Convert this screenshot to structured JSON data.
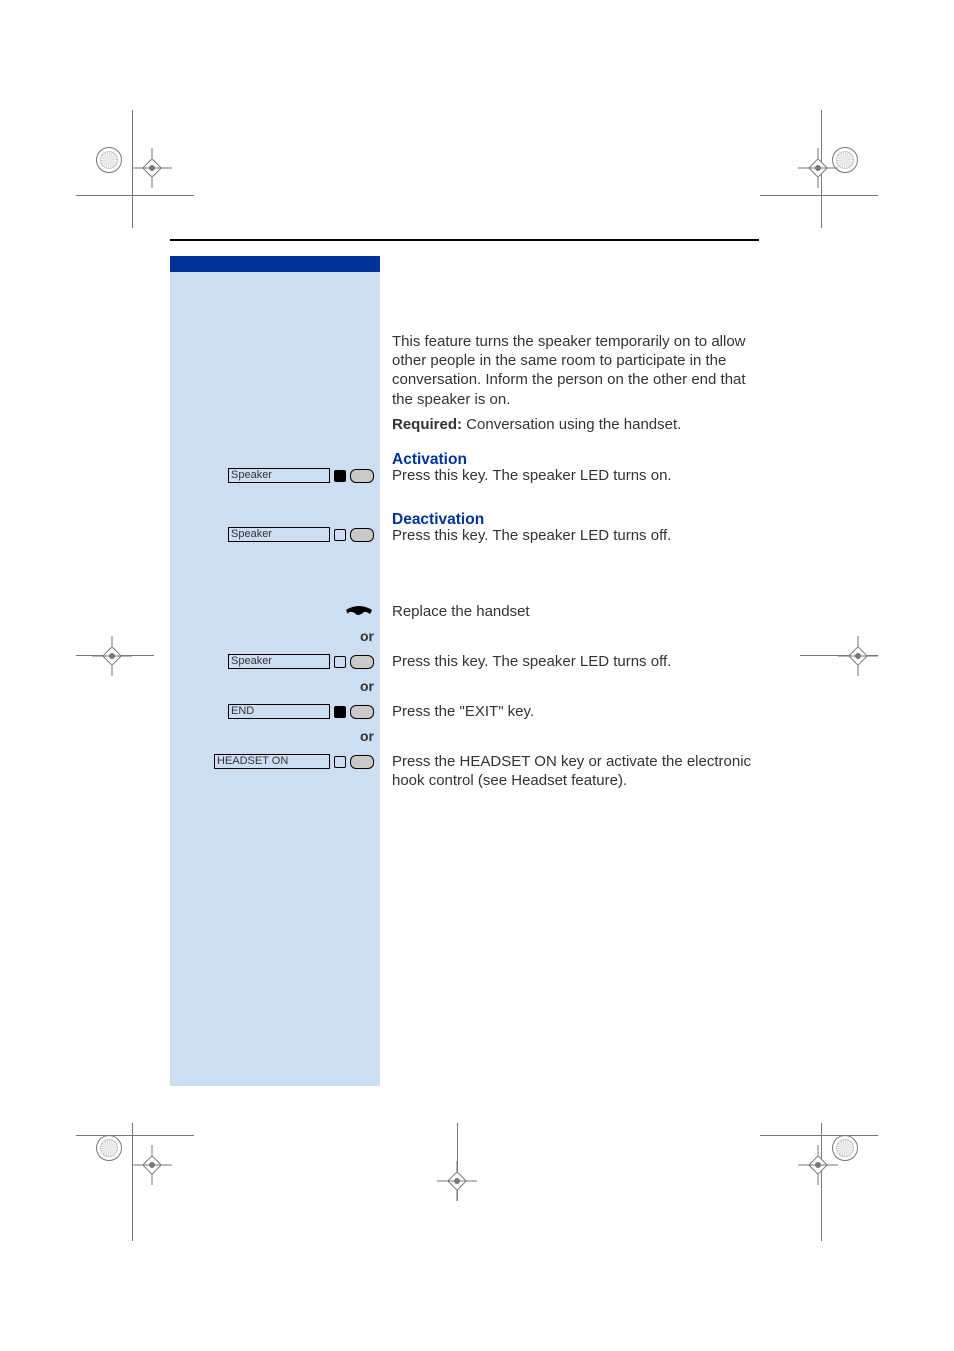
{
  "intro": "This feature turns the speaker temporarily on to allow other people in the same room to participate in the conversation. Inform the person on the other end that the speaker is on.",
  "required_label": "Required:",
  "required_text": " Conversation using the handset.",
  "activation": {
    "title": "Activation",
    "key": "Speaker",
    "text": "Press this key. The speaker LED turns on."
  },
  "deactivation": {
    "title": "Deactivation",
    "key": "Speaker",
    "text": "Press this key. The speaker LED turns off."
  },
  "ending": {
    "replace": "Replace the handset",
    "or": "or",
    "speaker_key": "Speaker",
    "speaker_text": "Press this key. The speaker LED turns off.",
    "end_key": "END",
    "end_text": "Press the \"EXIT\" key.",
    "headset_key": "HEADSET ON",
    "headset_text": "Press the HEADSET ON key or activate the electronic hook control (see Headset feature)."
  }
}
